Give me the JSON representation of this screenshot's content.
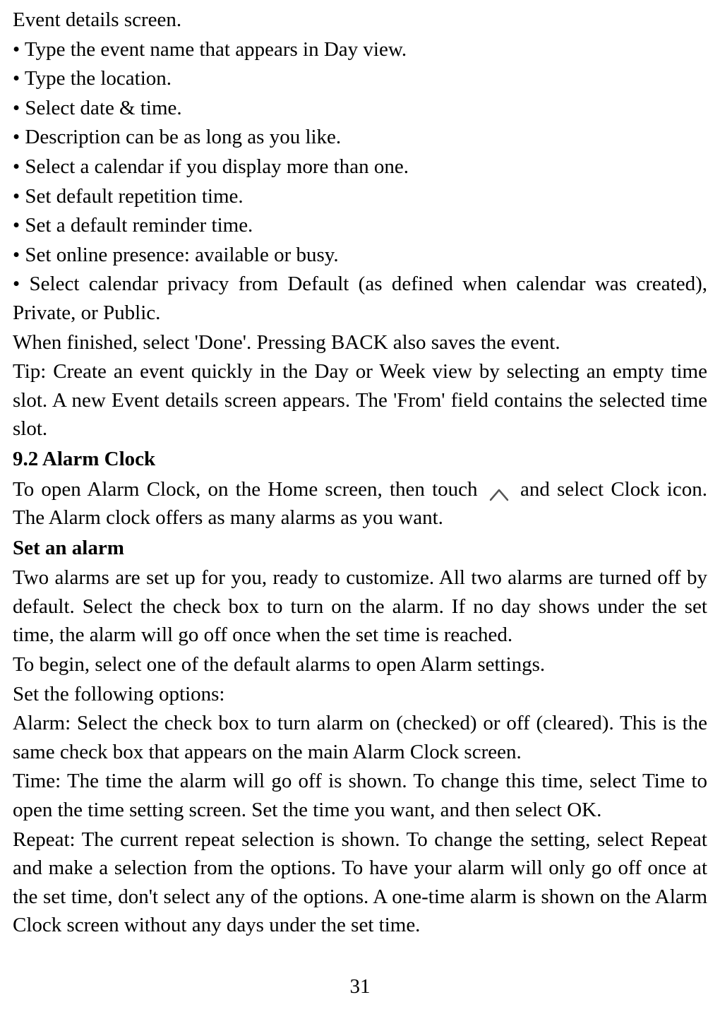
{
  "intro_line": "Event details screen.",
  "bullets": [
    "• Type the event name that appears in Day view.",
    "• Type the location.",
    "• Select date & time.",
    "• Description can be as long as you like.",
    "• Select a calendar if you display more than one.",
    "• Set default repetition time.",
    "• Set a default reminder time.",
    "• Set online presence: available or busy.",
    "• Select calendar privacy from Default (as defined when calendar was created), Private, or Public."
  ],
  "when_finished": "When finished, select 'Done'. Pressing BACK also saves the event.",
  "tip": "Tip: Create an event quickly in the Day or Week view by selecting an empty time slot. A new Event details screen appears. The 'From' field contains the selected time slot.",
  "section_9_2_heading": "9.2 Alarm Clock",
  "alarm_open_pre": "To open Alarm Clock, on the Home screen, then touch ",
  "alarm_open_post": " and select Clock icon. The Alarm clock offers as many alarms as you want.",
  "set_alarm_heading": "Set an alarm",
  "set_alarm_p1": "Two alarms are set up for you, ready to customize. All two alarms are turned off by default. Select the check box to turn on the alarm. If no day shows under the set time, the alarm will go off once when the set time is reached.",
  "set_alarm_p2": "To begin, select one of the default alarms to open Alarm settings.",
  "set_alarm_p3": "Set the following options:",
  "option_alarm": "Alarm: Select the check box to turn alarm on (checked) or off (cleared). This is the same check box that appears on the main Alarm Clock screen.",
  "option_time": "Time: The time the alarm will go off is shown. To change this time, select Time to open the time setting screen. Set the time you want, and then select OK.",
  "option_repeat": "Repeat: The current repeat selection is shown. To change the setting, select Repeat and make a selection from the options. To have your alarm will only go off once at the set time, don't select any of the options. A one-time alarm is shown on the Alarm Clock screen without any days under the set time.",
  "page_number": "31"
}
